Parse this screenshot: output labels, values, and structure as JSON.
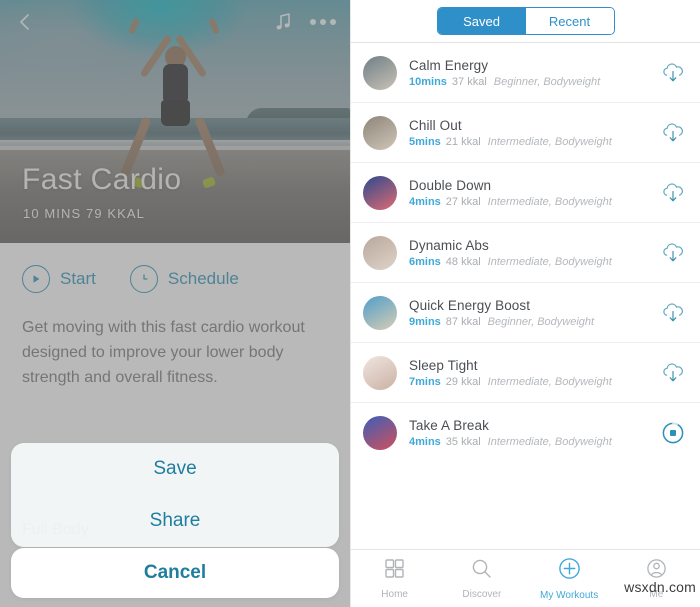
{
  "left": {
    "topbar": {
      "back_icon": "chevron-left-icon",
      "music_icon": "music-note-icon",
      "more_icon": "more-options-icon"
    },
    "hero": {
      "title": "Fast Cardio",
      "subtitle": "10 MINS  79 KKAL"
    },
    "actions": [
      {
        "label": "Start",
        "icon": "play-icon"
      },
      {
        "label": "Schedule",
        "icon": "clock-icon"
      }
    ],
    "description": "Get moving with this fast cardio workout designed to improve your lower body strength and overall fitness.",
    "sub_tag": "Full Body",
    "action_sheet": {
      "items": [
        "Save",
        "Share"
      ],
      "cancel": "Cancel"
    }
  },
  "right": {
    "segmented": {
      "options": [
        "Saved",
        "Recent"
      ],
      "selected": "Saved"
    },
    "workouts": [
      {
        "title": "Calm Energy",
        "time": "10mins",
        "kcal": "37 kkal",
        "tags": "Beginner, Bodyweight",
        "action": "download-icon",
        "thumb_a": "#6f7e86",
        "thumb_b": "#c9c2b6"
      },
      {
        "title": "Chill Out",
        "time": "5mins",
        "kcal": "21 kkal",
        "tags": "Intermediate, Bodyweight",
        "action": "download-icon",
        "thumb_a": "#8d8578",
        "thumb_b": "#cfc6b8"
      },
      {
        "title": "Double Down",
        "time": "4mins",
        "kcal": "27 kkal",
        "tags": "Intermediate, Bodyweight",
        "action": "download-icon",
        "thumb_a": "#2b4a8f",
        "thumb_b": "#e06a72"
      },
      {
        "title": "Dynamic Abs",
        "time": "6mins",
        "kcal": "48 kkal",
        "tags": "Intermediate, Bodyweight",
        "action": "download-icon",
        "thumb_a": "#b9a79b",
        "thumb_b": "#ded3c9"
      },
      {
        "title": "Quick Energy Boost",
        "time": "9mins",
        "kcal": "87 kkal",
        "tags": "Beginner, Bodyweight",
        "action": "download-icon",
        "thumb_a": "#4f9ec9",
        "thumb_b": "#d8cdb6"
      },
      {
        "title": "Sleep Tight",
        "time": "7mins",
        "kcal": "29 kkal",
        "tags": "Intermediate, Bodyweight",
        "action": "download-icon",
        "thumb_a": "#efe6e0",
        "thumb_b": "#cbb0a4"
      },
      {
        "title": "Take A Break",
        "time": "4mins",
        "kcal": "35 kkal",
        "tags": "Intermediate, Bodyweight",
        "action": "stop-download-icon",
        "thumb_a": "#3a5fb8",
        "thumb_b": "#d2505c"
      }
    ],
    "tabbar": [
      {
        "label": "Home",
        "icon": "grid-icon",
        "active": false
      },
      {
        "label": "Discover",
        "icon": "search-icon",
        "active": false
      },
      {
        "label": "My Workouts",
        "icon": "plus-circle-icon",
        "active": true
      },
      {
        "label": "Me",
        "icon": "person-icon",
        "active": false
      }
    ],
    "watermark": "wsxdn.com"
  },
  "colors": {
    "accent": "#41a8d8",
    "segment": "#2f8fc8",
    "link": "#1f7e9e"
  }
}
